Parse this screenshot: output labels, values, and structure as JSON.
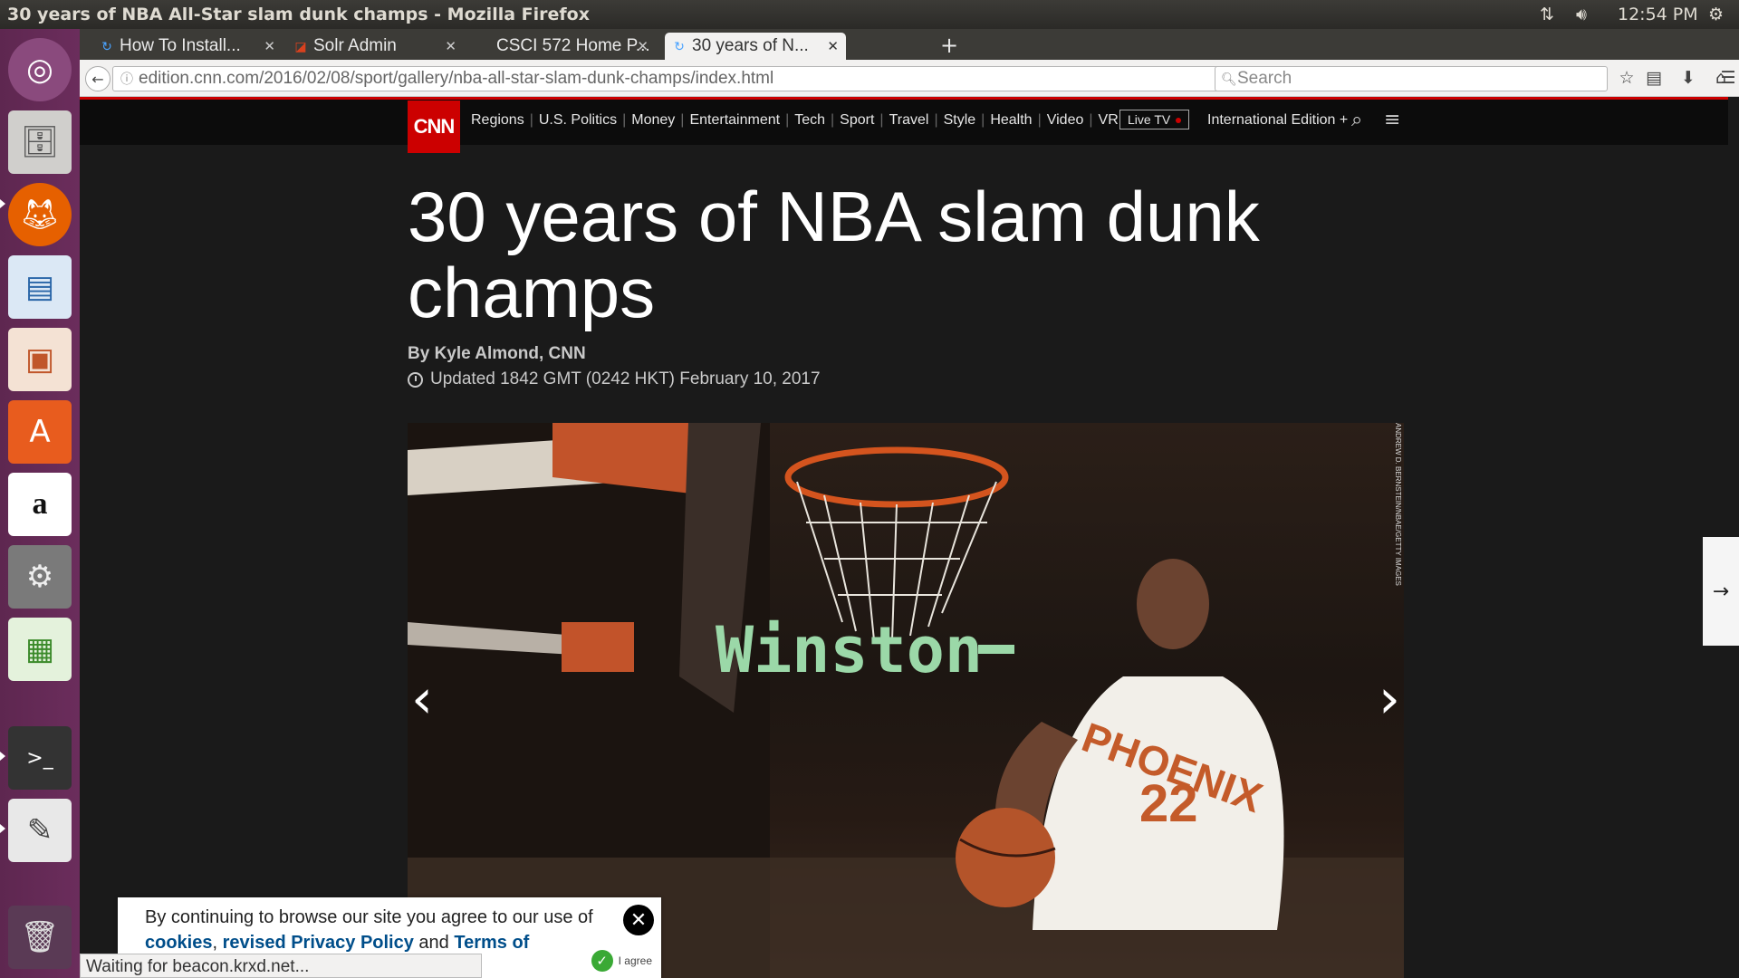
{
  "window": {
    "title": "30 years of NBA All-Star slam dunk champs - Mozilla Firefox",
    "clock": "12:54 PM"
  },
  "launcher": {
    "items": [
      "ubuntu-icon",
      "files-icon",
      "firefox-icon",
      "writer-icon",
      "impress-icon",
      "software-center-icon",
      "amazon-icon",
      "system-settings-icon",
      "calc-icon",
      "terminal-icon",
      "text-editor-icon",
      "trash-icon"
    ]
  },
  "tabs": [
    {
      "label": "How To Install...",
      "active": false
    },
    {
      "label": "Solr Admin",
      "active": false
    },
    {
      "label": "CSCI 572 Home P...",
      "active": false
    },
    {
      "label": "30 years of N...",
      "active": true
    }
  ],
  "urlbar": {
    "url": "edition.cnn.com/2016/02/08/sport/gallery/nba-all-star-slam-dunk-champs/index.html",
    "search_placeholder": "Search"
  },
  "cnn": {
    "logo": "CNN",
    "nav": [
      "Regions",
      "U.S. Politics",
      "Money",
      "Entertainment",
      "Tech",
      "Sport",
      "Travel",
      "Style",
      "Health",
      "Video",
      "VR"
    ],
    "live_tv": "Live TV",
    "edition": "International Edition +"
  },
  "article": {
    "headline": "30 years of NBA slam dunk champs",
    "byline": "By Kyle Almond, CNN",
    "updated": "Updated 1842 GMT (0242 HKT) February 10, 2017"
  },
  "gallery": {
    "photo_credit": "ANDREW D. BERNSTEIN/NBAE/GETTY IMAGES",
    "sign_text": "Winston",
    "jersey_text": "PHOENIX",
    "jersey_number": "22"
  },
  "cookie": {
    "text_start": "By continuing to browse our site you agree to our use of",
    "link_cookies": "cookies",
    "link_privacy": "revised Privacy Policy",
    "and": "and",
    "link_terms": "Terms of",
    "agree": "I agree"
  },
  "status": {
    "text": "Waiting for beacon.krxd.net..."
  }
}
